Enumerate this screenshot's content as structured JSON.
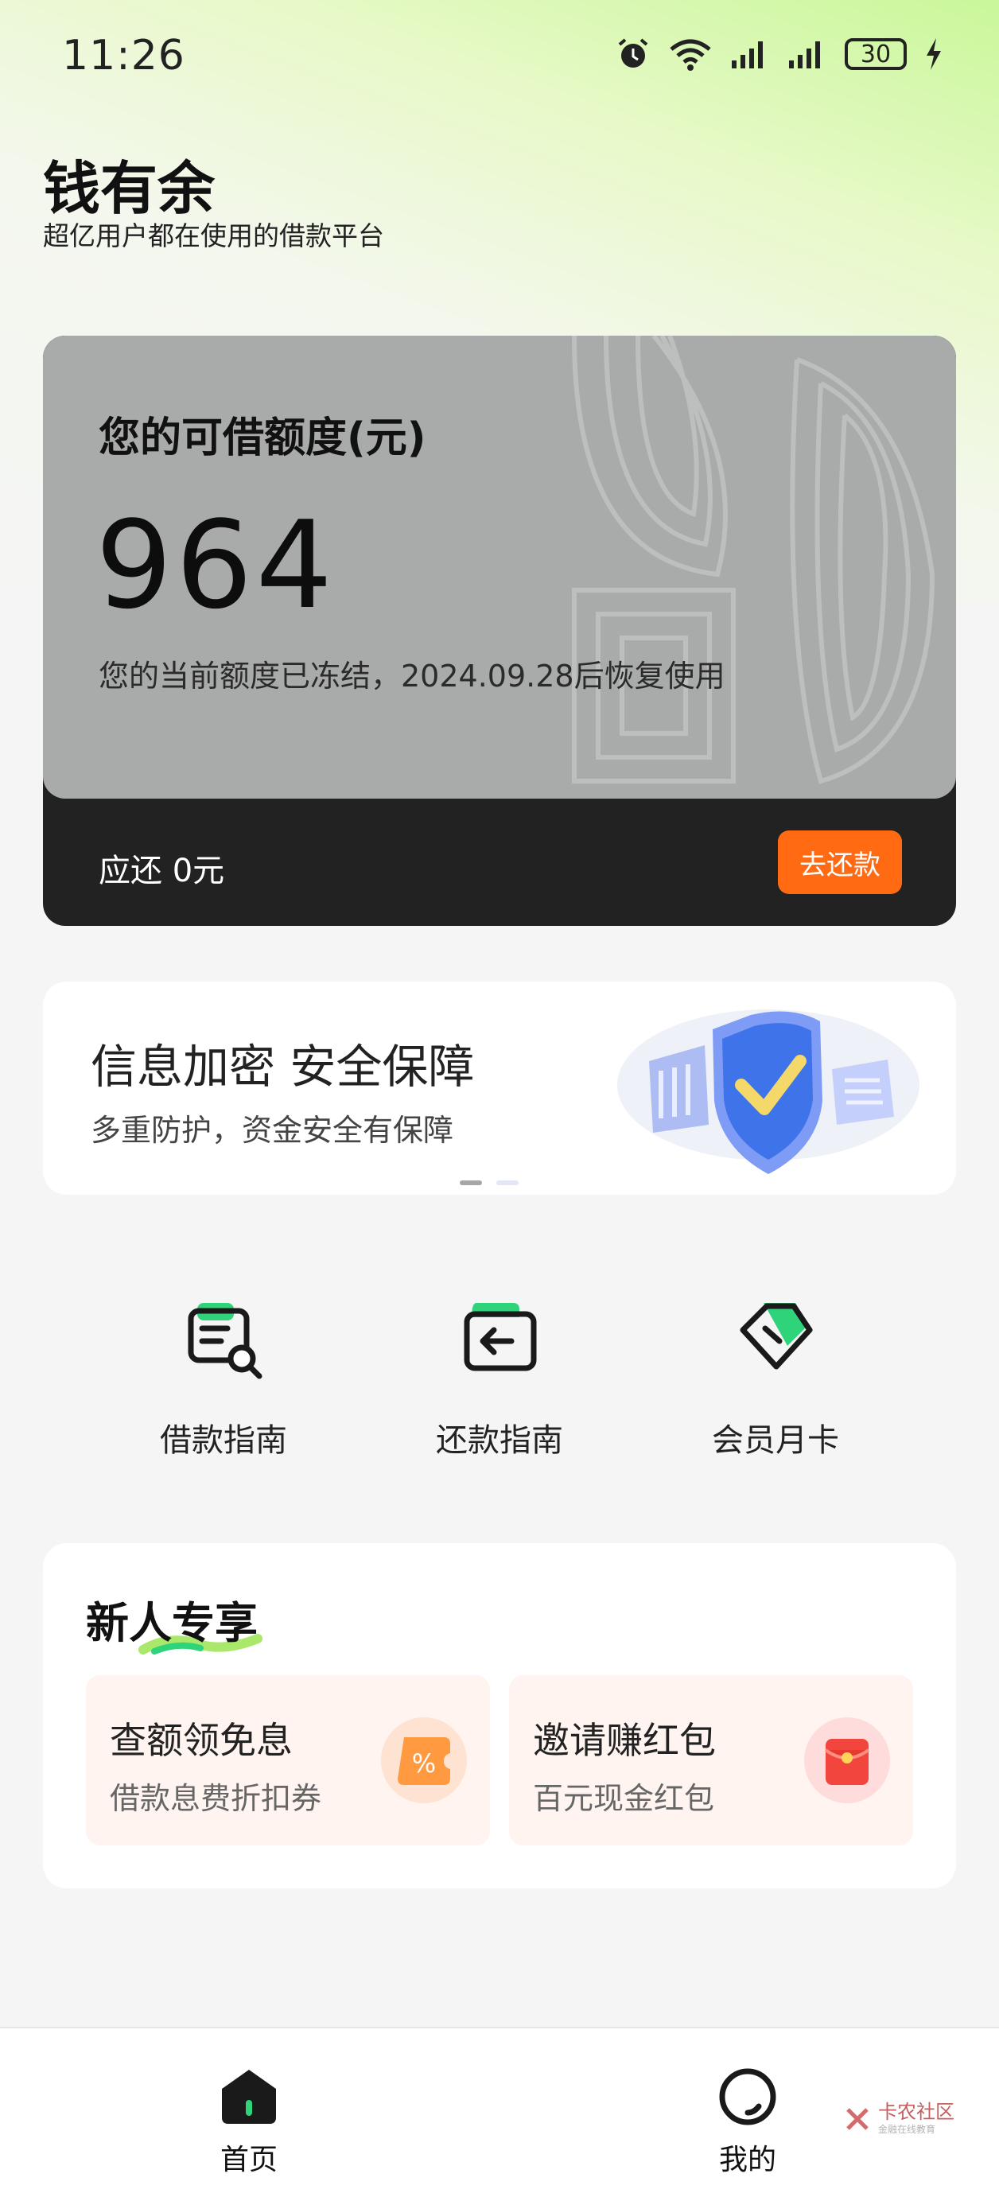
{
  "status_bar": {
    "time": "11:26",
    "battery": "30",
    "icons": [
      "alarm-icon",
      "wifi-icon",
      "signal-icon",
      "signal-icon",
      "battery-icon",
      "charging-icon"
    ]
  },
  "header": {
    "title": "钱有余",
    "subtitle": "超亿用户都在使用的借款平台"
  },
  "credit_card": {
    "label": "您的可借额度(元)",
    "amount": "964",
    "note": "您的当前额度已冻结，2024.09.28后恢复使用",
    "due_text": "应还 0元",
    "repay_button": "去还款"
  },
  "banner": {
    "title": "信息加密 安全保障",
    "subtitle": "多重防护，资金安全有保障",
    "page_count": 2,
    "active_page": 1
  },
  "quick_actions": [
    {
      "label": "借款指南",
      "icon": "loan-guide-icon"
    },
    {
      "label": "还款指南",
      "icon": "repay-guide-icon"
    },
    {
      "label": "会员月卡",
      "icon": "member-card-icon"
    }
  ],
  "new_user": {
    "title": "新人专享",
    "promos": [
      {
        "title": "查额领免息",
        "subtitle": "借款息费折扣券",
        "icon": "discount-coupon-icon"
      },
      {
        "title": "邀请赚红包",
        "subtitle": "百元现金红包",
        "icon": "red-envelope-icon"
      }
    ]
  },
  "bottom_nav": {
    "items": [
      {
        "label": "首页",
        "icon": "home-icon",
        "active": true
      },
      {
        "label": "我的",
        "icon": "profile-icon",
        "active": false
      }
    ]
  },
  "watermark": {
    "text": "卡农社区",
    "subtext": "金融在线教育"
  },
  "colors": {
    "accent_green": "#2ed37a",
    "repay_button": "#ff6a13",
    "card_gray": "#a9abaa",
    "card_dark": "#222222"
  }
}
